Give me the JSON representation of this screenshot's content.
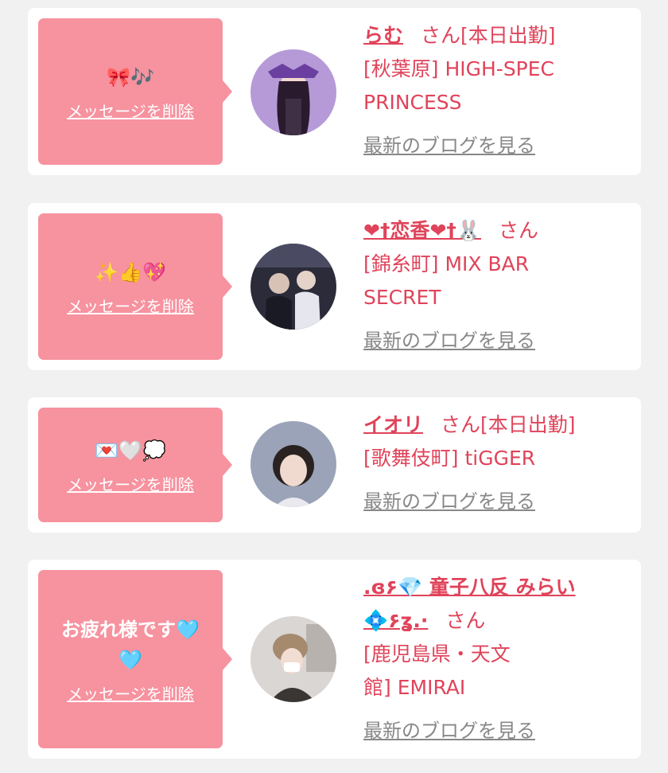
{
  "delete_label": "メッセージを削除",
  "blog_label": "最新のブログを見る",
  "cards": [
    {
      "message": "🎀🎶",
      "name": "らむ",
      "suffix": "さん[本日出勤]",
      "shop": "[秋葉原] HIGH-SPEC PRINCESS"
    },
    {
      "message": "✨👍💖",
      "name": "❤︎†恋香❤︎†🐰",
      "suffix": "さん",
      "shop": "[錦糸町] MIX BAR SECRET"
    },
    {
      "message": "💌🤍💭",
      "name": "イオリ",
      "suffix": "さん[本日出勤]",
      "shop": "[歌舞伎町] tiGGER"
    },
    {
      "message": "お疲れ様です🩵🩵",
      "name": ".ɞ۶💎 童子八反 みらい💠۶ʓ.·",
      "suffix": "さん",
      "shop": "[鹿児島県・天文館] EMIRAI"
    }
  ]
}
